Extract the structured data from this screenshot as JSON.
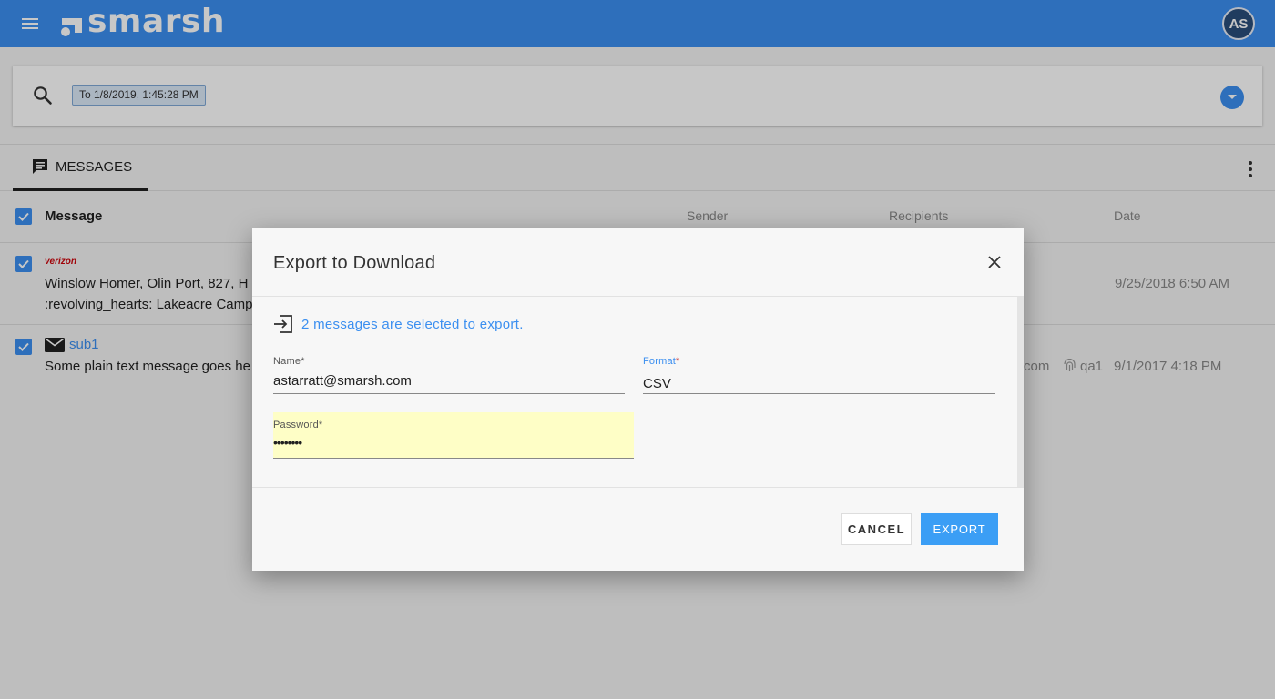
{
  "header": {
    "app_name": "smarsh",
    "user_initials": "AS"
  },
  "search": {
    "date_filter": "To 1/8/2019, 1:45:28 PM"
  },
  "tabs": [
    {
      "label": "MESSAGES",
      "icon": "message-icon",
      "active": true
    }
  ],
  "table": {
    "columns": [
      "Message",
      "Sender",
      "Recipients",
      "Date"
    ],
    "rows": [
      {
        "source": "verizon",
        "source_icon": "verizon-logo",
        "line1": "Winslow Homer, Olin Port, 827, H",
        "line2": ":revolving_hearts: Lakeacre Camp",
        "date": "9/25/2018 6:50 AM"
      },
      {
        "source_icon": "mail-icon",
        "subject": "sub1",
        "line1": "Some plain text message goes he",
        "recipient_partial": "com",
        "recipient_partial2": "qa1",
        "date": "9/1/2017 4:18 PM"
      }
    ]
  },
  "dialog": {
    "title": "Export to Download",
    "info": "2 messages are selected to export.",
    "name_label": "Name",
    "name_value": "astarratt@smarsh.com",
    "format_label": "Format",
    "format_value": "CSV",
    "password_label": "Password",
    "password_value": "••••••••",
    "required_mark": "*",
    "cancel_label": "CANCEL",
    "export_label": "EXPORT"
  },
  "colors": {
    "brand": "#3b8ff0",
    "required": "#c62828",
    "autofill": "#fefec6"
  }
}
